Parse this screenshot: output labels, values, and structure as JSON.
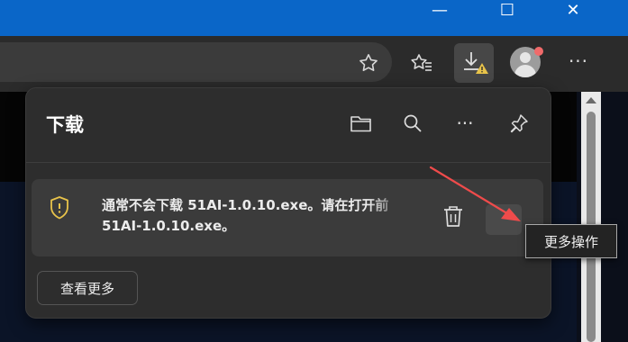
{
  "window": {
    "minimize_glyph": "—",
    "maximize_glyph": "☐",
    "close_glyph": "✕"
  },
  "toolbar": {
    "icons": [
      "star-icon",
      "favorites-icon",
      "downloads-warning-icon",
      "profile-avatar",
      "more-icon"
    ],
    "more_glyph": "···"
  },
  "downloads": {
    "title": "下载",
    "header_icons": [
      "open-folder-icon",
      "search-icon",
      "more-options-icon",
      "pin-icon"
    ],
    "header_more_glyph": "···",
    "item": {
      "line1": "通常不会下载 51AI-1.0.10.exe。请在打开前",
      "line2": "51AI-1.0.10.exe。",
      "status_icon": "shield-warning-icon"
    },
    "see_more": "查看更多",
    "tooltip": "更多操作"
  },
  "colors": {
    "titlebar": "#0a66c8",
    "warning": "#e8c34a",
    "annotation_arrow": "#ef4b4b"
  }
}
